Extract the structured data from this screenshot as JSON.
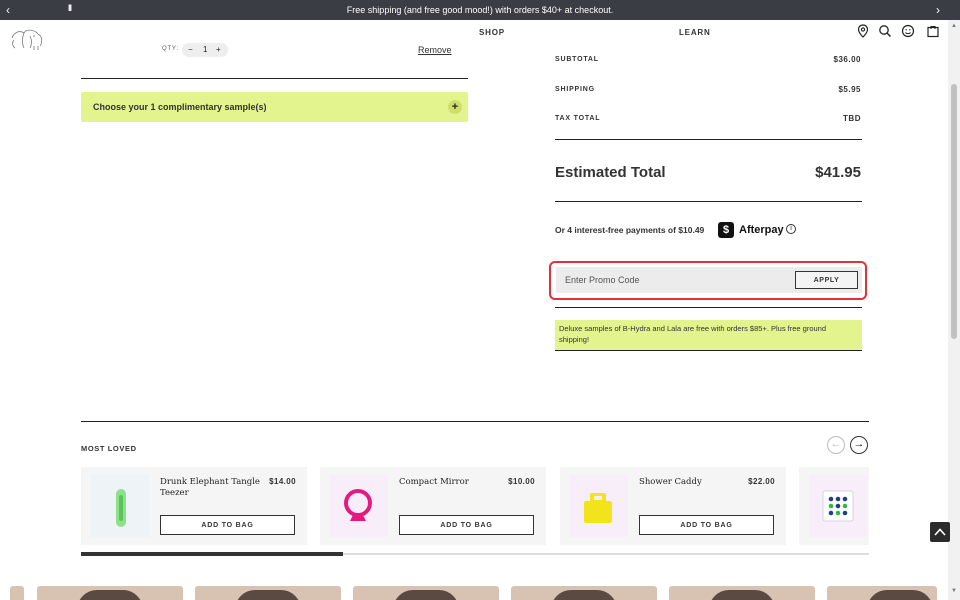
{
  "announcement": {
    "message": "Free shipping (and free good mood!) with orders $40+ at checkout.",
    "prev_icon": "‹",
    "next_icon": "›",
    "pause_icon": "II"
  },
  "nav": {
    "shop": "SHOP",
    "learn": "LEARN",
    "icons": [
      "location-pin-icon",
      "search-icon",
      "account-icon",
      "bag-icon"
    ]
  },
  "cart_item": {
    "qty_label": "QTY:",
    "minus": "−",
    "qty_value": "1",
    "plus": "+",
    "remove": "Remove"
  },
  "sample": {
    "label": "Choose your 1 complimentary sample(s)",
    "toggle": "+"
  },
  "summary": {
    "subtotal_label": "SUBTOTAL",
    "subtotal_value": "$36.00",
    "shipping_label": "SHIPPING",
    "shipping_value": "$5.95",
    "tax_label": "TAX TOTAL",
    "tax_value": "TBD",
    "estimated_label": "Estimated Total",
    "estimated_value": "$41.95"
  },
  "afterpay": {
    "text": "Or 4 interest-free payments of $10.49",
    "logo_glyph": "$",
    "brand": "Afterpay",
    "info": "i"
  },
  "promo": {
    "placeholder": "Enter Promo Code",
    "apply": "APPLY",
    "highlight_color": "#e0323b"
  },
  "note": "Deluxe samples of B-Hydra and Lala are free with orders $85+. Plus free ground shipping!",
  "most_loved": {
    "title": "MOST LOVED",
    "prev": "←",
    "next": "→",
    "products": [
      {
        "name": "Drunk Elephant Tangle Teezer",
        "price": "$14.00",
        "button": "ADD TO BAG"
      },
      {
        "name": "Compact Mirror",
        "price": "$10.00",
        "button": "ADD TO BAG"
      },
      {
        "name": "Shower Caddy",
        "price": "$22.00",
        "button": "ADD TO BAG"
      }
    ]
  },
  "colors": {
    "accent_green": "#e3f48e",
    "announce_bg": "#3a3d44"
  }
}
